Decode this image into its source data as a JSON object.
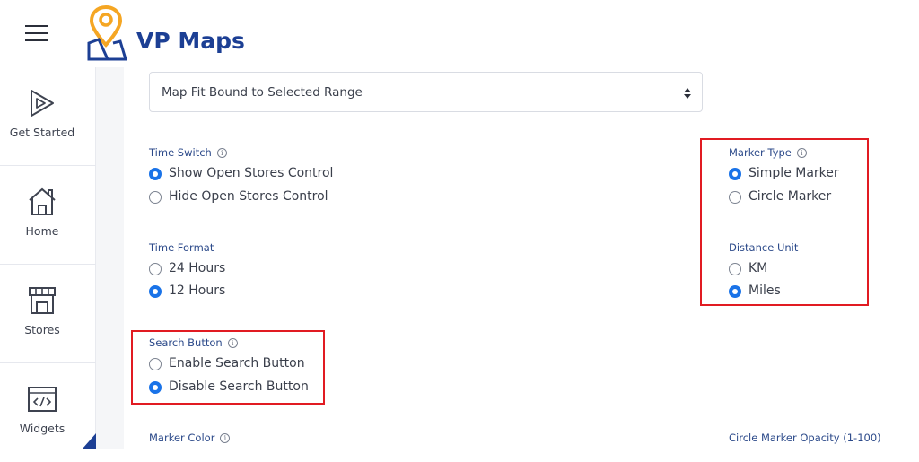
{
  "header": {
    "menu_icon": "hamburger-icon",
    "logo_letter": "W",
    "logo_text": "VP Maps"
  },
  "sidebar": {
    "items": [
      {
        "label": "Get Started",
        "icon": "play-icon"
      },
      {
        "label": "Home",
        "icon": "home-icon"
      },
      {
        "label": "Stores",
        "icon": "store-icon"
      },
      {
        "label": "Widgets",
        "icon": "code-window-icon"
      }
    ]
  },
  "settings": {
    "map_fit_select": {
      "value": "Map Fit Bound to Selected Range"
    },
    "time_switch": {
      "label": "Time Switch",
      "options": [
        "Show Open Stores Control",
        "Hide Open Stores Control"
      ],
      "selected": "Show Open Stores Control"
    },
    "time_format": {
      "label": "Time Format",
      "options": [
        "24 Hours",
        "12 Hours"
      ],
      "selected": "12 Hours"
    },
    "search_button": {
      "label": "Search Button",
      "options": [
        "Enable Search Button",
        "Disable Search Button"
      ],
      "selected": "Disable Search Button"
    },
    "marker_type": {
      "label": "Marker Type",
      "options": [
        "Simple Marker",
        "Circle Marker"
      ],
      "selected": "Simple Marker"
    },
    "distance_unit": {
      "label": "Distance Unit",
      "options": [
        "KM",
        "Miles"
      ],
      "selected": "Miles"
    },
    "marker_color": {
      "label": "Marker Color"
    },
    "circle_marker_opacity": {
      "label": "Circle Marker Opacity (1-100)"
    }
  },
  "colors": {
    "brand": "#1c3f94",
    "accent_orange": "#f5a623",
    "radio_selected": "#1a73e8",
    "highlight_box": "#e11b22"
  }
}
